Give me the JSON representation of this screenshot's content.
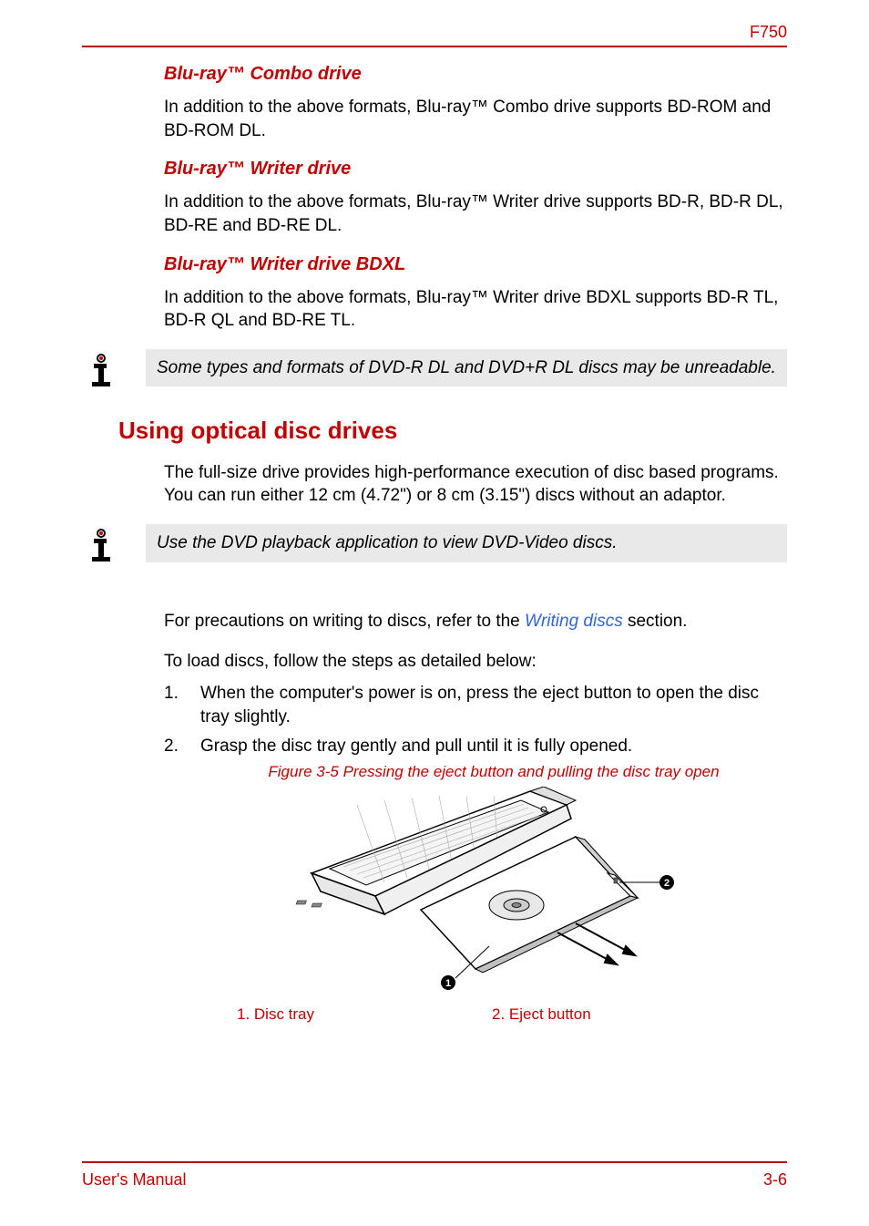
{
  "header": {
    "model": "F750"
  },
  "sections": {
    "combo": {
      "heading": "Blu-ray™ Combo drive",
      "text": "In addition to the above formats, Blu-ray™ Combo drive supports BD-ROM and BD-ROM DL."
    },
    "writer": {
      "heading": "Blu-ray™ Writer drive",
      "text": "In addition to the above formats, Blu-ray™ Writer drive supports BD-R, BD-R DL, BD-RE and BD-RE DL."
    },
    "bdxl": {
      "heading": "Blu-ray™ Writer drive BDXL",
      "text": "In addition to the above formats, Blu-ray™ Writer drive BDXL supports BD-R TL, BD-R QL and BD-RE TL."
    },
    "note1": "Some types and formats of DVD-R DL and DVD+R DL discs may be unreadable.",
    "using": {
      "heading": "Using optical disc drives",
      "text": "The full-size drive provides high-performance execution of disc based programs. You can run either 12 cm (4.72\") or 8 cm (3.15\") discs without an adaptor."
    },
    "note2": "Use the DVD playback application to view DVD-Video discs.",
    "precautions_pre": "For precautions on writing to discs, refer to the ",
    "precautions_link": "Writing discs",
    "precautions_post": " section.",
    "load_intro": "To load discs, follow the steps as detailed below:",
    "steps": [
      {
        "num": "1.",
        "text": "When the computer's power is on, press the eject button to open the disc tray slightly."
      },
      {
        "num": "2.",
        "text": "Grasp the disc tray gently and pull until it is fully opened."
      }
    ],
    "figure": {
      "caption": "Figure 3-5 Pressing the eject button and pulling the disc tray open",
      "callout1": "1. Disc tray",
      "callout2": "2. Eject button"
    }
  },
  "footer": {
    "left": "User's Manual",
    "right": "3-6"
  }
}
